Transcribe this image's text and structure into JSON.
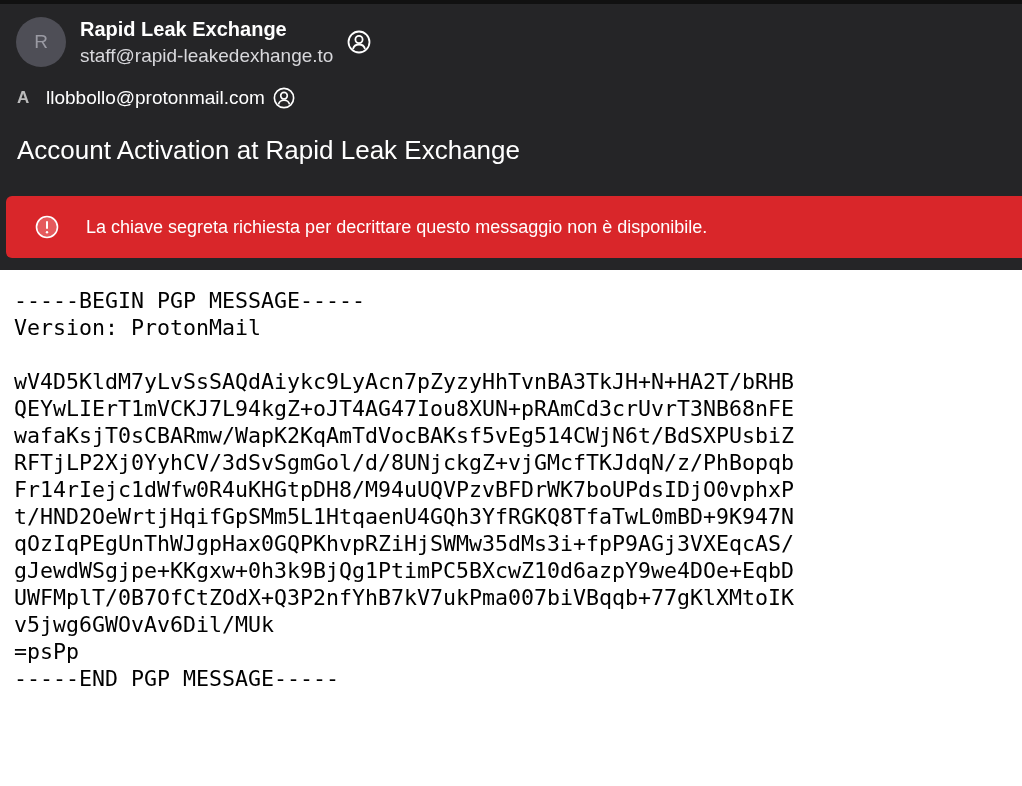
{
  "sender": {
    "avatar_letter": "R",
    "name": "Rapid Leak Exchange",
    "address": "staff@rapid-leakedexhange.to"
  },
  "recipient": {
    "label": "A",
    "address": "llobbollo@protonmail.com"
  },
  "subject": "Account Activation at Rapid Leak Exchange",
  "error_banner": {
    "message": "La chiave segreta richiesta per decrittare questo messaggio non è disponibile."
  },
  "message": {
    "armor_header": [
      "-----BEGIN PGP MESSAGE-----",
      "Version: ProtonMail"
    ],
    "body_lines": [
      "wV4D5KldM7yLvSsSAQdAiykc9LyAcn7pZyzyHhTvnBA3TkJH+N+HA2T/bRHB",
      "QEYwLIErT1mVCKJ7L94kgZ+oJT4AG47Iou8XUN+pRAmCd3crUvrT3NB68nFE",
      "wafaKsjT0sCBARmw/WapK2KqAmTdVocBAKsf5vEg514CWjN6t/BdSXPUsbiZ",
      "RFTjLP2Xj0YyhCV/3dSvSgmGol/d/8UNjckgZ+vjGMcfTKJdqN/z/PhBopqb",
      "Fr14rIejc1dWfw0R4uKHGtpDH8/M94uUQVPzvBFDrWK7boUPdsIDjO0vphxP",
      "t/HND2OeWrtjHqifGpSMm5L1HtqaenU4GQh3YfRGKQ8TfaTwL0mBD+9K947N",
      "qOzIqPEgUnThWJgpHax0GQPKhvpRZiHjSWMw35dMs3i+fpP9AGj3VXEqcAS/",
      "gJewdWSgjpe+KKgxw+0h3k9BjQg1PtimPC5BXcwZ10d6azpY9we4DOe+EqbD",
      "UWFMplT/0B7OfCtZOdX+Q3P2nfYhB7kV7ukPma007biVBqqb+77gKlXMtoIK",
      "v5jwg6GWOvAv6Dil/MUk",
      "=psPp",
      "-----END PGP MESSAGE-----"
    ]
  }
}
